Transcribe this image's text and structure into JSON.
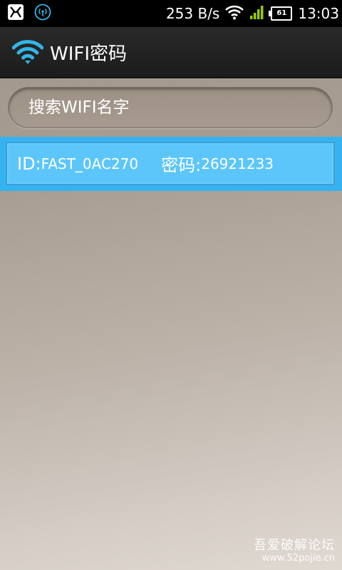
{
  "status_bar": {
    "net_speed": "253 B/s",
    "battery": "61",
    "time": "13:03",
    "icons": [
      "notification-app-icon",
      "broadcast-icon",
      "wifi-icon",
      "signal-icon",
      "battery-icon"
    ]
  },
  "action_bar": {
    "title": "WIFI密码",
    "icon": "wifi-icon",
    "accent": "#33b5e5"
  },
  "search": {
    "placeholder": "搜索WIFI名字",
    "value": ""
  },
  "list": {
    "items": [
      {
        "id_label": "ID:",
        "id_value": "FAST_0AC270",
        "password_label": "密码:",
        "password_value": "26921233",
        "selected": true
      }
    ],
    "selected_color": "#5cc6fb"
  },
  "watermark": {
    "title": "吾爱破解论坛",
    "url": "www.52pojie.cn"
  }
}
